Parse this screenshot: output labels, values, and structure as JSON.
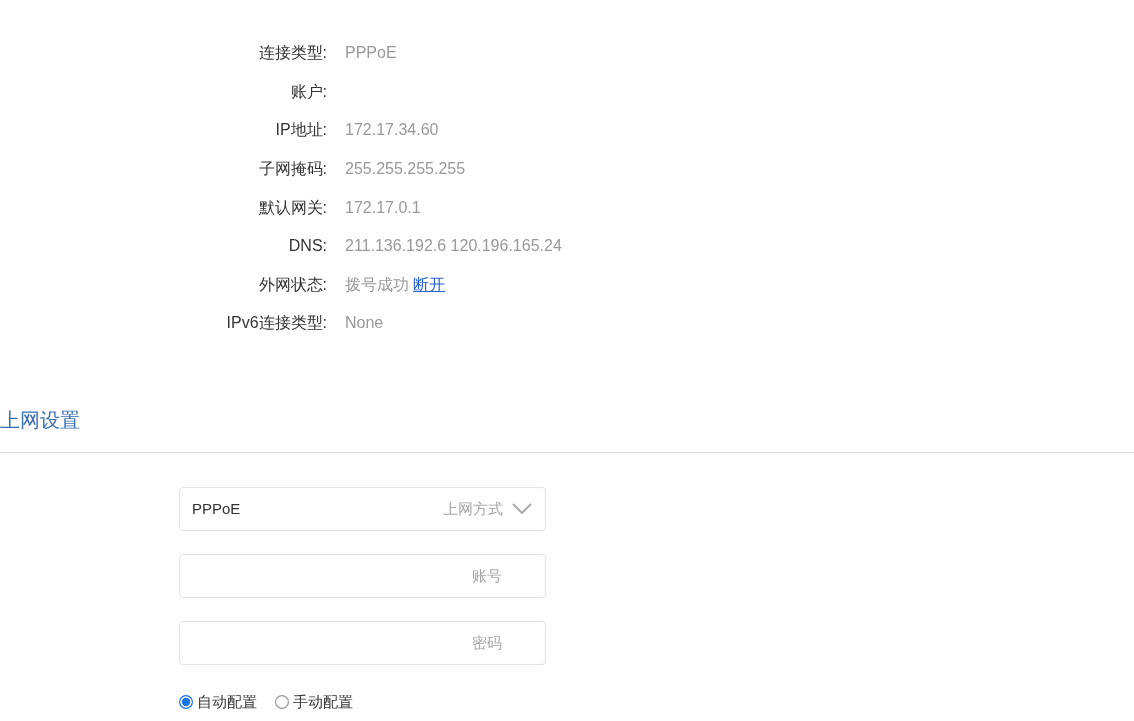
{
  "connection_info": [
    {
      "label": "连接类型:",
      "value": "PPPoE"
    },
    {
      "label": "账户:"
    },
    {
      "label": "IP地址:",
      "value": "172.17.34.60"
    },
    {
      "label": "子网掩码:",
      "value": "255.255.255.255"
    },
    {
      "label": "默认网关:",
      "value": "172.17.0.1"
    },
    {
      "label": "DNS:",
      "value": "211.136.192.6 120.196.165.24"
    },
    {
      "label": "外网状态:",
      "value": "拨号成功",
      "link": "断开"
    },
    {
      "label": "IPv6连接类型:",
      "value": "None"
    }
  ],
  "internet_settings": {
    "title": "上网设置",
    "fields": [
      {
        "kind": "select",
        "value": "PPPoE",
        "label": "上网方式"
      },
      {
        "kind": "text",
        "placeholder": "账号"
      },
      {
        "kind": "password",
        "placeholder": "密码"
      }
    ],
    "config_modes": [
      {
        "label": "自动配置",
        "selected": true
      },
      {
        "label": "手动配置",
        "selected": false
      }
    ]
  }
}
